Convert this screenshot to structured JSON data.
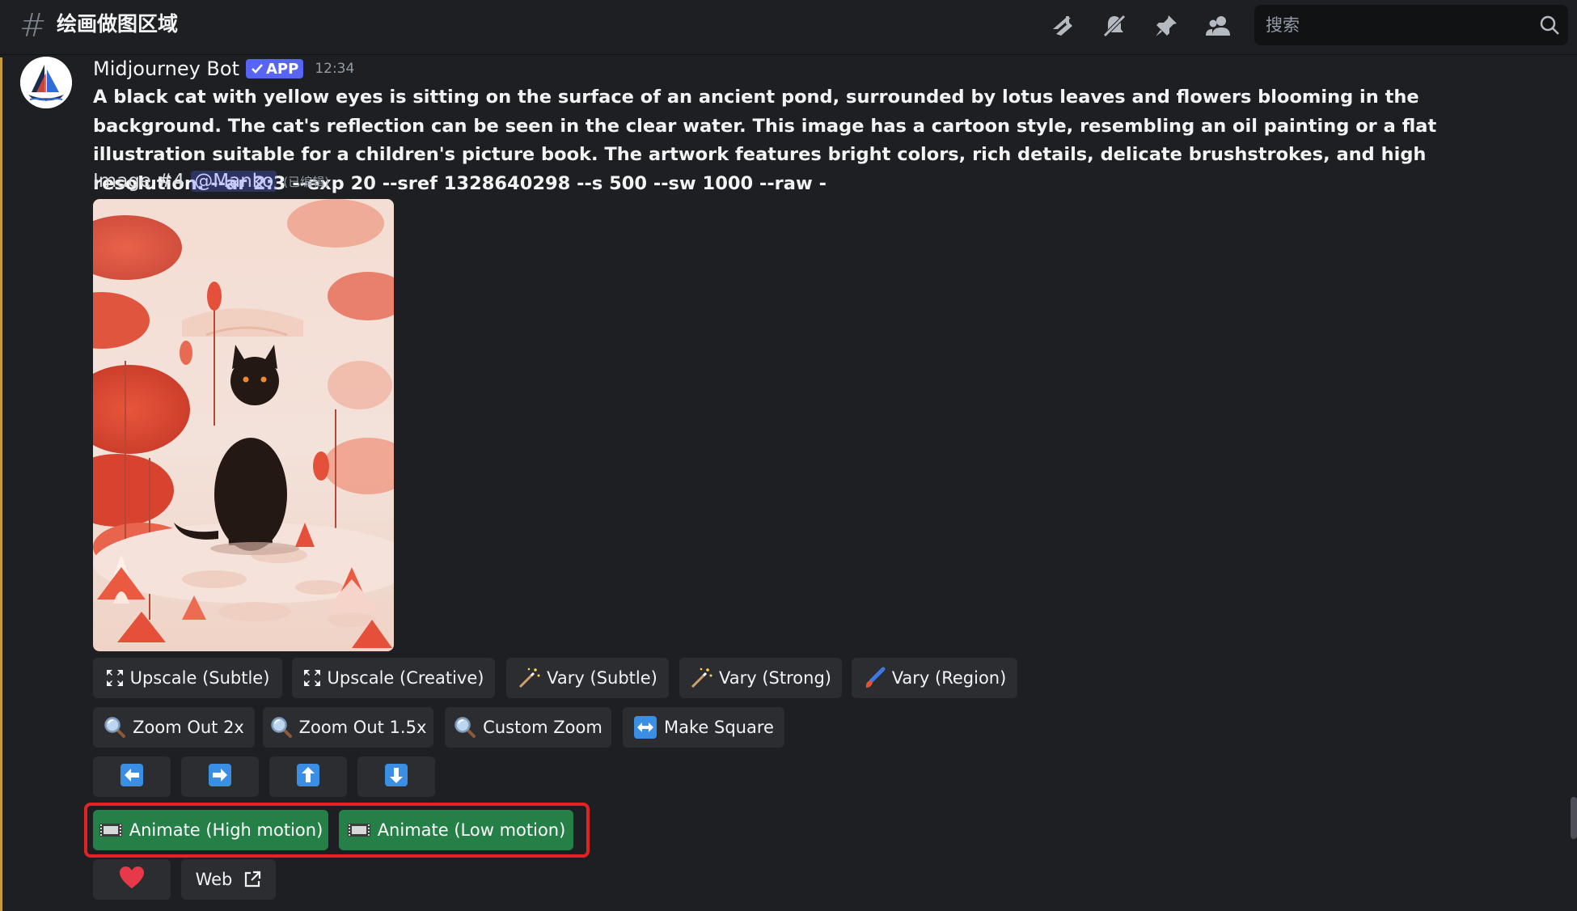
{
  "header": {
    "channel_name": "绘画做图区域",
    "search_placeholder": "搜索",
    "icons": [
      "threads-icon",
      "mute-icon",
      "pin-icon",
      "members-icon"
    ]
  },
  "message": {
    "username": "Midjourney Bot",
    "badge": "APP",
    "timestamp": "12:34",
    "prompt": "A black cat with yellow eyes is sitting on the surface of an ancient pond, surrounded by lotus leaves and flowers blooming in the background. The cat's reflection can be seen in the clear water. This image has a cartoon style, resembling an oil painting or a flat illustration suitable for a children's picture book. The artwork features bright colors, rich details, delicate brushstrokes, and high resolution. --ar 2:3 --exp 20 --sref 1328640298 --s 500 --sw 1000 --raw -",
    "image_label": "Image #4",
    "mention": "@Manko",
    "edited": "(已编辑)"
  },
  "buttons": {
    "row1": [
      "Upscale (Subtle)",
      "Upscale (Creative)",
      "Vary (Subtle)",
      "Vary (Strong)",
      "Vary (Region)"
    ],
    "row2": [
      "Zoom Out 2x",
      "Zoom Out 1.5x",
      "Custom Zoom",
      "Make Square"
    ],
    "row3": [
      "pan-left",
      "pan-right",
      "pan-up",
      "pan-down"
    ],
    "row4": [
      "Animate (High motion)",
      "Animate (Low motion)"
    ],
    "row5": [
      "heart",
      "Web"
    ]
  },
  "colors": {
    "background": "#1e1f22",
    "button": "#2b2d31",
    "green_button": "#248046",
    "highlight": "#e32222",
    "badge": "#5865f2"
  }
}
